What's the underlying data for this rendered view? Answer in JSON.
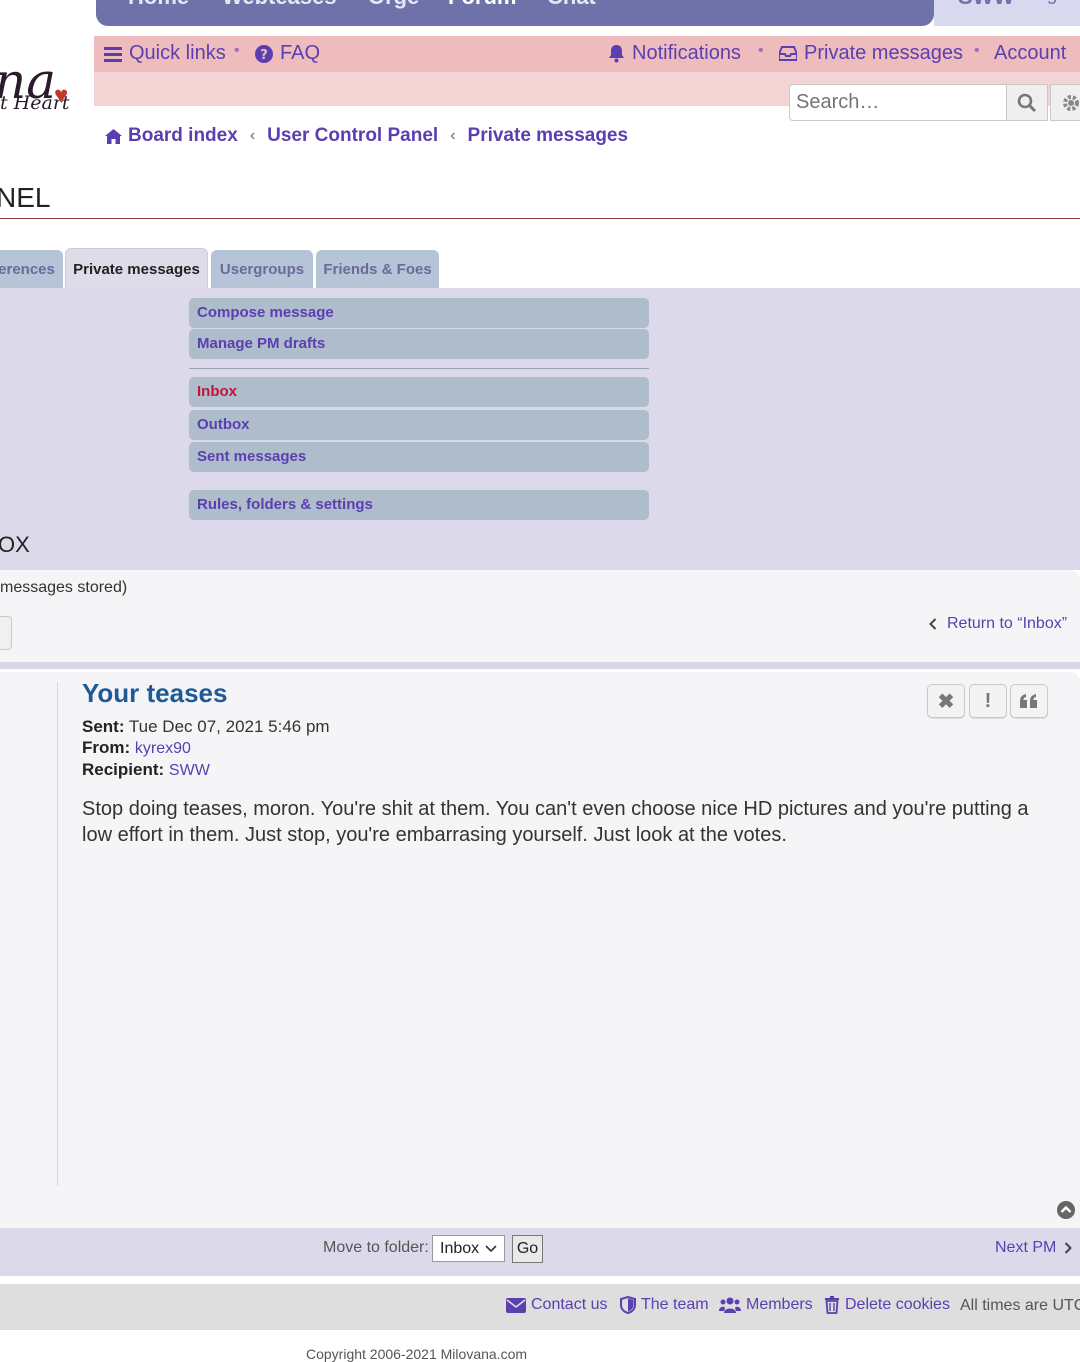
{
  "top_nav": {
    "items": [
      "Home",
      "Webteases",
      "Orge",
      "Forum",
      "Chat"
    ],
    "user": "SWW",
    "logout": "logout"
  },
  "logo": {
    "text_big": "na",
    "text_small": "t Heart"
  },
  "quick_nav": {
    "quick_links": "Quick links",
    "faq": "FAQ",
    "notifications": "Notifications",
    "private_messages": "Private messages",
    "account": "Account"
  },
  "search": {
    "placeholder": "Search…"
  },
  "breadcrumbs": [
    "Board index",
    "User Control Panel",
    "Private messages"
  ],
  "panel": {
    "title": "NEL"
  },
  "tabs": [
    "erences",
    "Private messages",
    "Usergroups",
    "Friends & Foes"
  ],
  "pm_menu": {
    "compose": "Compose message",
    "drafts": "Manage PM drafts",
    "inbox": "Inbox",
    "outbox": "Outbox",
    "sent": "Sent messages",
    "rules": "Rules, folders & settings"
  },
  "section": {
    "title": "OX",
    "stored": "messages stored)",
    "return": "Return to “Inbox”"
  },
  "message": {
    "subject": "Your teases",
    "sent_label": "Sent:",
    "sent_value": "Tue Dec 07, 2021 5:46 pm",
    "from_label": "From:",
    "from_value": "kyrex90",
    "recipient_label": "Recipient:",
    "recipient_value": "SWW",
    "body": "Stop doing teases, moron. You're shit at them. You can't even choose nice HD pictures and you're putting a low effort in them. Just stop, you're embarrasing yourself. Just look at the votes."
  },
  "move": {
    "label": "Move to folder:",
    "selected": "Inbox",
    "go": "Go",
    "next": "Next PM"
  },
  "footer": {
    "contact": "Contact us",
    "team": "The team",
    "members": "Members",
    "cookies": "Delete cookies",
    "times": "All times are UTC",
    "copyright": "Copyright 2006-2021 Milovana.com"
  },
  "colors": {
    "link": "#5a3fb0",
    "subject": "#1e5a96",
    "current": "#c0143c",
    "panel": "#dcdaea",
    "nav": "#6f72a8"
  }
}
